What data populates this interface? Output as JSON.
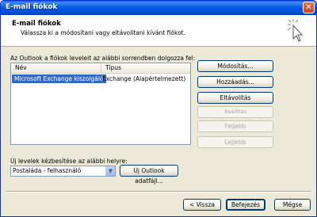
{
  "window": {
    "title": "E-mail fiókok"
  },
  "header": {
    "title": "E-mail fiókok",
    "description": "Válassza ki a módosítani vagy eltávolítani kívánt fiókot."
  },
  "accounts": {
    "label": "Az Outlook a fiókok leveleit az alábbi sorrendben dolgozza fel:",
    "columns": [
      "Név",
      "Típus"
    ],
    "rows": [
      {
        "name": "Microsoft Exchange kiszolgáló",
        "type": "Exchange (Alapértelmezett)",
        "selected": true
      }
    ]
  },
  "buttons": {
    "modify": "Módosítás...",
    "add": "Hozzáadás...",
    "remove": "Eltávolítás",
    "set_default": "Beállítás alapértelmezettként",
    "up": "Feljebb",
    "down": "Lejjebb",
    "new_data_file": "Új Outlook adatfájl...",
    "back": "< Vissza",
    "finish": "Befejezés",
    "cancel": "Mégse"
  },
  "delivery": {
    "label": "Új levelek kézbesítése az alábbi helyre:",
    "selected": "Postaláda -  felhasználó"
  },
  "colors": {
    "title_bar": "#0054e3",
    "selection": "#316ac5",
    "dialog_bg": "#ece9d8"
  },
  "icons": {
    "close": "close-icon",
    "header": "cursor-click-icon",
    "dropdown": "chevron-down-icon"
  }
}
